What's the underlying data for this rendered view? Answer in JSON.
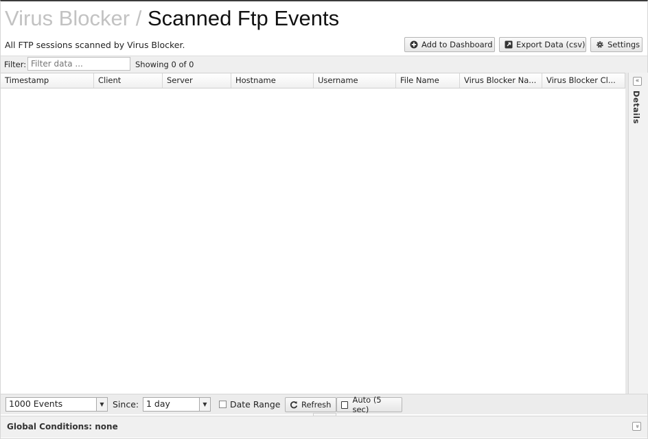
{
  "header": {
    "app_name": "Virus Blocker",
    "separator": "/",
    "page_title": "Scanned Ftp Events",
    "description": "All FTP sessions scanned by Virus Blocker."
  },
  "toolbar": {
    "add_dashboard": "Add to Dashboard",
    "export": "Export Data (csv)",
    "settings": "Settings"
  },
  "filter": {
    "label": "Filter:",
    "placeholder": "Filter data ...",
    "showing": "Showing 0 of 0"
  },
  "grid": {
    "columns": [
      "Timestamp",
      "Client",
      "Server",
      "Hostname",
      "Username",
      "File Name",
      "Virus Blocker Na...",
      "Virus Blocker Cl..."
    ],
    "rows": []
  },
  "details_panel": {
    "label": "Details",
    "toggle_icon": "«"
  },
  "bottom": {
    "events_select": "1000 Events",
    "since_label": "Since:",
    "since_select": "1 day",
    "date_range_label": "Date Range",
    "refresh": "Refresh",
    "auto": "Auto (5 sec)"
  },
  "global_conditions": {
    "text": "Global Conditions: none",
    "toggle_icon": "»"
  },
  "colors": {
    "title_muted": "#c2c2c2",
    "title_main": "#111111",
    "panel_bg": "#efefef"
  }
}
